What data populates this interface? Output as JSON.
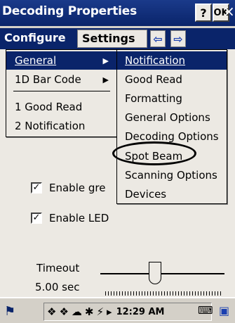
{
  "window": {
    "title": "Decoding Properties",
    "help_label": "?",
    "ok_label": "OK",
    "close_label": "×"
  },
  "menubar": {
    "configure": "Configure",
    "settings": "Settings",
    "nav_left": "⇦",
    "nav_right": "⇨"
  },
  "settings_menu": {
    "items": [
      {
        "label": "General",
        "underline": "G",
        "has_submenu": true,
        "selected": true
      },
      {
        "label": "1D Bar Code",
        "has_submenu": true
      },
      {
        "label": "1 Good Read"
      },
      {
        "label": "2 Notification"
      }
    ]
  },
  "general_submenu": {
    "items": [
      {
        "label": "Notification"
      },
      {
        "label": "Good Read"
      },
      {
        "label": "Formatting"
      },
      {
        "label": "General Options"
      },
      {
        "label": "Decoding Options"
      },
      {
        "label": "Spot Beam",
        "highlighted": true
      },
      {
        "label": "Scanning Options"
      },
      {
        "label": "Devices"
      }
    ]
  },
  "content": {
    "checkbox1_label": "Enable gre",
    "checkbox2_label": "Enable LED",
    "checkbox1_checked": true,
    "checkbox2_checked": true,
    "timeout_label": "Timeout",
    "timeout_value": "5.00 sec",
    "check_mark": "✓"
  },
  "taskbar": {
    "time": "12:29 AM"
  },
  "colors": {
    "accent": "#0a246a",
    "menu_bg": "#ece9e3"
  }
}
